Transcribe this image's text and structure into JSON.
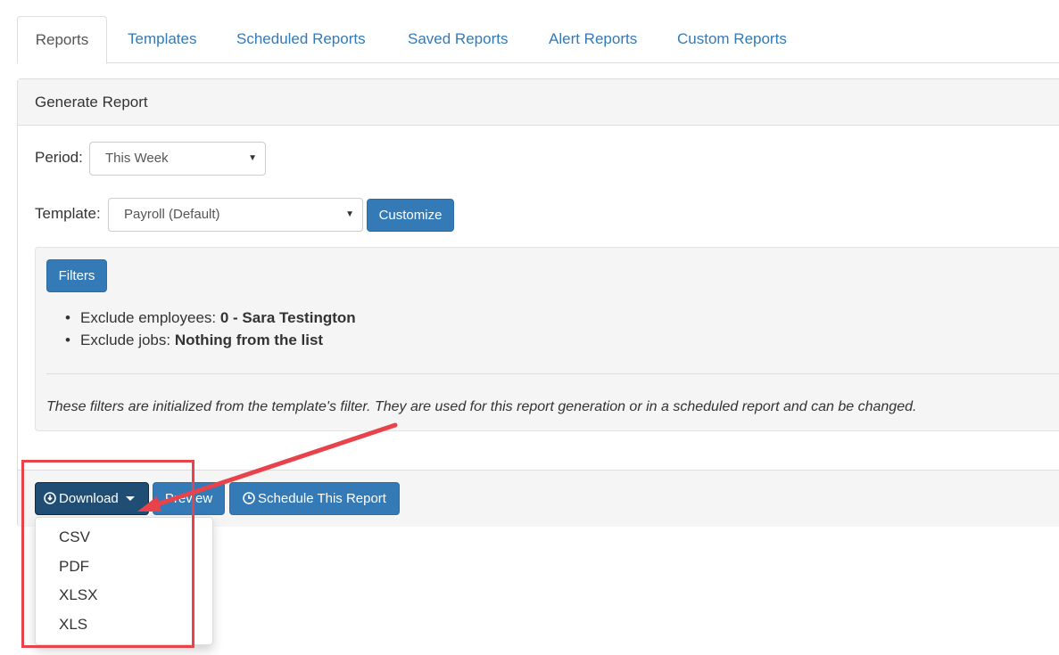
{
  "tabs": [
    {
      "label": "Reports",
      "active": true
    },
    {
      "label": "Templates"
    },
    {
      "label": "Scheduled Reports"
    },
    {
      "label": "Saved Reports"
    },
    {
      "label": "Alert Reports"
    },
    {
      "label": "Custom Reports"
    }
  ],
  "panel": {
    "heading": "Generate Report",
    "period": {
      "label": "Period:",
      "value": "This Week"
    },
    "template": {
      "label": "Template:",
      "value": "Payroll (Default)",
      "customize_label": "Customize"
    },
    "filters": {
      "button_label": "Filters",
      "items": [
        {
          "prefix": "Exclude employees:",
          "value": "0 - Sara Testington"
        },
        {
          "prefix": "Exclude jobs:",
          "value": "Nothing from the list"
        }
      ],
      "note": "These filters are initialized from the template's filter. They are used for this report generation or in a scheduled report and can be changed."
    },
    "footer": {
      "download_label": "Download",
      "preview_label": "Preview",
      "schedule_label": "Schedule This Report"
    }
  },
  "download_menu": {
    "options": [
      "CSV",
      "PDF",
      "XLSX",
      "XLS"
    ]
  },
  "colors": {
    "primary": "#337ab7",
    "primary_dark": "#204d74",
    "annotation_red": "#e8424a"
  }
}
